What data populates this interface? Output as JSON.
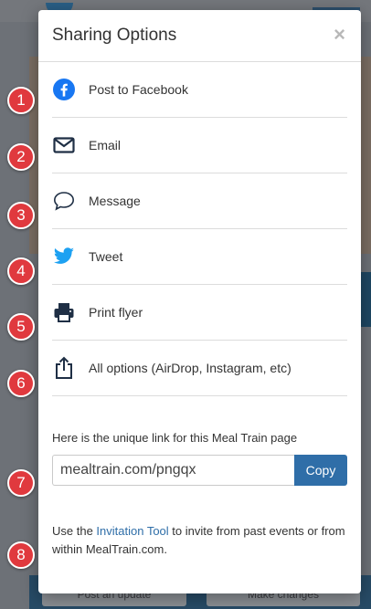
{
  "background": {
    "post_update_label": "Post an update",
    "make_changes_label": "Make changes"
  },
  "modal": {
    "title": "Sharing Options",
    "close_symbol": "×",
    "options": [
      {
        "label": "Post to Facebook",
        "icon": "facebook-icon"
      },
      {
        "label": "Email",
        "icon": "envelope-icon"
      },
      {
        "label": "Message",
        "icon": "chat-bubble-icon"
      },
      {
        "label": "Tweet",
        "icon": "twitter-bird-icon"
      },
      {
        "label": "Print flyer",
        "icon": "printer-icon"
      },
      {
        "label": "All options (AirDrop, Instagram, etc)",
        "icon": "share-upload-icon"
      }
    ],
    "link_intro": "Here is the unique link for this Meal Train page",
    "link_value": "mealtrain.com/pngqx",
    "copy_label": "Copy",
    "invite_prefix": "Use the ",
    "invite_link": "Invitation Tool",
    "invite_suffix": " to invite from past events or from within MealTrain.com."
  },
  "markers": [
    "1",
    "2",
    "3",
    "4",
    "5",
    "6",
    "7",
    "8"
  ],
  "colors": {
    "facebook": "#1877f2",
    "twitter": "#1da1f2",
    "icon_dark": "#1f2f45",
    "accent": "#2f6ea8",
    "marker": "#e0393e"
  }
}
